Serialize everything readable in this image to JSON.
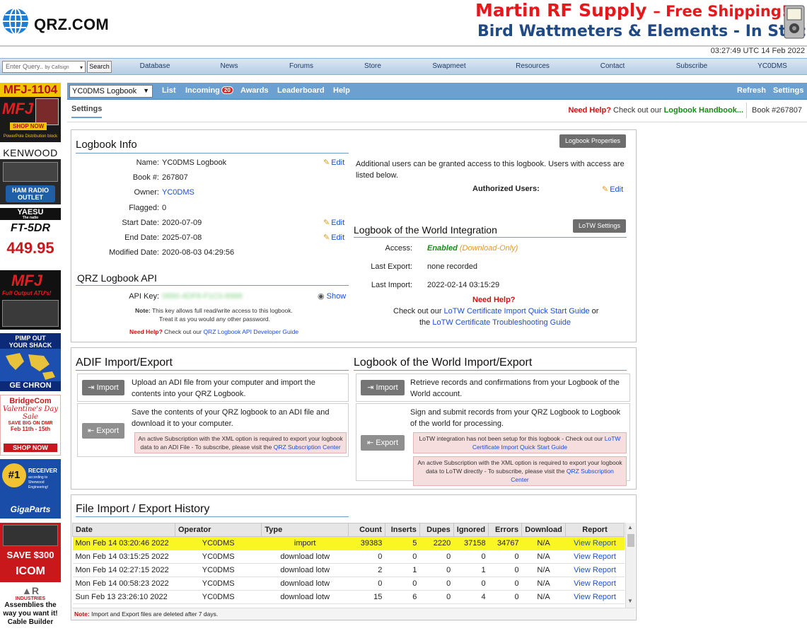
{
  "header": {
    "logo_text": "QRZ.COM",
    "banner_line1": "Martin RF Supply",
    "banner_dash": "– Free Shipping!",
    "banner_line2": "Bird Wattmeters & Elements - In Stock"
  },
  "time": "03:27:49 UTC 14 Feb 2022",
  "search": {
    "placeholder": "Enter Query..",
    "mode": "by Callsign",
    "button": "Search"
  },
  "nav": [
    "Database",
    "News",
    "Forums",
    "Store",
    "Swapmeet",
    "Resources",
    "Contact",
    "Subscribe",
    "YC0DMS"
  ],
  "ads": {
    "mfj1104": {
      "title": "MFJ-1104",
      "brand": "MFJ",
      "cta": "SHOP NOW",
      "caption": "PowerPole Distribution block"
    },
    "kenwood": {
      "brand": "KENWOOD",
      "store": "HAM RADIO OUTLET"
    },
    "yaesu": {
      "brand": "YAESU",
      "tag": "The radio",
      "model": "FT-5DR",
      "price": "449.95"
    },
    "mfj_atu": {
      "brand": "MFJ",
      "line1": "Full Output ATU's!"
    },
    "geochron": {
      "line1": "PIMP OUT",
      "line2": "YOUR SHACK",
      "brand": "GE CHRON"
    },
    "bridgecom": {
      "brand": "BridgeCom",
      "line1": "Valentine's Day",
      "line2": "Sale",
      "line3": "SAVE BIG ON DMR",
      "line4": "Feb 11th - 15th",
      "cta": "SHOP NOW"
    },
    "gigaparts": {
      "rank": "#1",
      "line1": "RECEIVER",
      "line2": "according to Sherwood Engineering!",
      "brand": "GigaParts"
    },
    "icom": {
      "save": "SAVE $300",
      "brand": "ICOM"
    },
    "abr": {
      "brand": "INDUSTRIES",
      "line1": "Assemblies the way you want it!",
      "line2": "Cable Builder"
    }
  },
  "logbook_bar": {
    "select": "YC0DMS Logbook",
    "links": [
      "List",
      "Incoming",
      "Awards",
      "Leaderboard",
      "Help"
    ],
    "incoming_count": "20",
    "right": [
      "Refresh",
      "Settings"
    ]
  },
  "subbar": {
    "tab": "Settings",
    "need_help": "Need Help?",
    "help_mid": "Check out our",
    "handbook": "Logbook Handbook...",
    "book": "Book #267807"
  },
  "logbook_info": {
    "title": "Logbook Info",
    "props_btn": "Logbook Properties",
    "edit": "Edit",
    "rows": [
      {
        "label": "Name:",
        "value": "YC0DMS Logbook"
      },
      {
        "label": "Book #:",
        "value": "267807"
      },
      {
        "label": "Owner:",
        "value": "YC0DMS"
      },
      {
        "label": "Flagged:",
        "value": "0"
      },
      {
        "label": "Start Date:",
        "value": "2020-07-09"
      },
      {
        "label": "End Date:",
        "value": "2025-07-08"
      },
      {
        "label": "Modified Date:",
        "value": "2020-08-03 04:29:56"
      }
    ],
    "users_text": "Additional users can be granted access to this logbook. Users with access are listed below.",
    "authorized": "Authorized Users:"
  },
  "api": {
    "title": "QRZ Logbook API",
    "label": "API Key:",
    "key": "0890-4DF8-F1C0-8988",
    "show": "Show",
    "note_label": "Note:",
    "note1": "This key allows full read/write access to this logbook.",
    "note2": "Treat it as you would any other password.",
    "help": "Need Help?",
    "help_mid": "Check out our",
    "guide": "QRZ Logbook API Developer Guide"
  },
  "lotw": {
    "title": "Logbook of the World Integration",
    "btn": "LoTW Settings",
    "access_label": "Access:",
    "access_value": "Enabled",
    "access_note": "(Download-Only)",
    "last_export_label": "Last Export:",
    "last_export_value": "none recorded",
    "last_import_label": "Last Import:",
    "last_import_value": "2022-02-14 03:15:29",
    "help": "Need Help?",
    "help_line1": "Check out our",
    "quick_start": "LoTW Certificate Import Quick Start Guide",
    "or": "or",
    "the": "the",
    "troubleshoot": "LoTW Certificate Troubleshooting Guide"
  },
  "adif": {
    "title": "ADIF Import/Export",
    "import_btn": "Import",
    "import_text": "Upload an ADI file from your computer and import the contents into your QRZ Logbook.",
    "export_btn": "Export",
    "export_text": "Save the contents of your QRZ logbook to an ADI file and download it to your computer.",
    "warn": "An active Subscription with the XML option is required to export your logbook data to an ADI File - To subscribe, please visit the",
    "warn_link": "QRZ Subscription Center"
  },
  "lotw_ie": {
    "title": "Logbook of the World Import/Export",
    "import_btn": "Import",
    "import_text": "Retrieve records and confirmations from your Logbook of the World account.",
    "export_btn": "Export",
    "export_text": "Sign and submit records from your QRZ Logbook to Logbook of the world for processing.",
    "warn1": "LoTW integration has not been setup for this logbook - Check out our",
    "warn1_link": "LoTW Certificate Import Quick Start Guide",
    "warn2": "An active Subscription with the XML option is required to export your logbook data to LoTW directly - To subscribe, please visit the",
    "warn2_link": "QRZ Subscription Center"
  },
  "history": {
    "title": "File Import / Export History",
    "columns": [
      "Date",
      "Operator",
      "Type",
      "Count",
      "Inserts",
      "Dupes",
      "Ignored",
      "Errors",
      "Download",
      "Report"
    ],
    "rows": [
      [
        "Mon Feb 14 03:20:46 2022",
        "YC0DMS",
        "import",
        "39383",
        "5",
        "2220",
        "37158",
        "34767",
        "N/A",
        "View Report"
      ],
      [
        "Mon Feb 14 03:15:25 2022",
        "YC0DMS",
        "download lotw",
        "0",
        "0",
        "0",
        "0",
        "0",
        "N/A",
        "View Report"
      ],
      [
        "Mon Feb 14 02:27:15 2022",
        "YC0DMS",
        "download lotw",
        "2",
        "1",
        "0",
        "1",
        "0",
        "N/A",
        "View Report"
      ],
      [
        "Mon Feb 14 00:58:23 2022",
        "YC0DMS",
        "download lotw",
        "0",
        "0",
        "0",
        "0",
        "0",
        "N/A",
        "View Report"
      ],
      [
        "Sun Feb 13 23:26:10 2022",
        "YC0DMS",
        "download lotw",
        "15",
        "6",
        "0",
        "4",
        "0",
        "N/A",
        "View Report"
      ]
    ],
    "note_label": "Note:",
    "note": "Import and Export files are deleted after 7 days."
  },
  "colors": {
    "nav_bg": "#c7d9ec",
    "logbook_bar": "#6ca0d0",
    "highlight": "#faf623",
    "banner_red": "#e5181b",
    "banner_blue": "#214a85"
  }
}
